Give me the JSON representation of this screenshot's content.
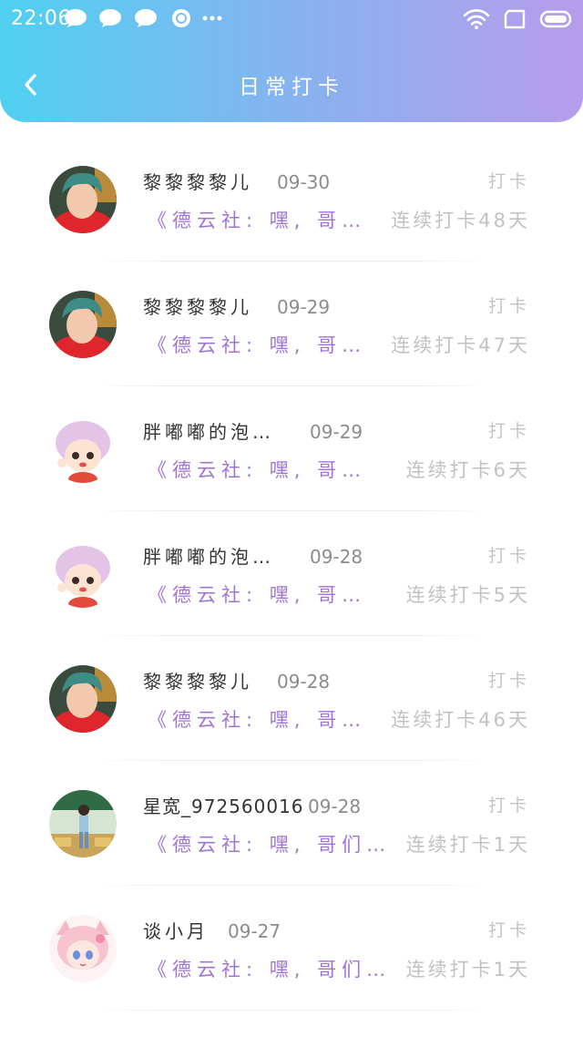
{
  "status_bar": {
    "time": "22:06"
  },
  "nav": {
    "title": "日常打卡"
  },
  "items": [
    {
      "name": "黎黎黎黎儿",
      "date": "09-30",
      "action": "打卡",
      "excerpt": "《德云社: 嘿, 哥…",
      "streak": "连续打卡48天",
      "avatar": "avatar-boy-green-hair"
    },
    {
      "name": "黎黎黎黎儿",
      "date": "09-29",
      "action": "打卡",
      "excerpt": "《德云社: 嘿, 哥…",
      "streak": "连续打卡47天",
      "avatar": "avatar-boy-green-hair"
    },
    {
      "name": "胖嘟嘟的泡…",
      "date": "09-29",
      "action": "打卡",
      "excerpt": "《德云社: 嘿, 哥…",
      "streak": "连续打卡6天",
      "avatar": "avatar-cartoon-pink-hair"
    },
    {
      "name": "胖嘟嘟的泡…",
      "date": "09-28",
      "action": "打卡",
      "excerpt": "《德云社: 嘿, 哥…",
      "streak": "连续打卡5天",
      "avatar": "avatar-cartoon-pink-hair"
    },
    {
      "name": "黎黎黎黎儿",
      "date": "09-28",
      "action": "打卡",
      "excerpt": "《德云社: 嘿, 哥…",
      "streak": "连续打卡46天",
      "avatar": "avatar-boy-green-hair"
    },
    {
      "name": "星宽_972560016",
      "date": "09-28",
      "action": "打卡",
      "excerpt": "《德云社: 嘿, 哥们…",
      "streak": "连续打卡1天",
      "avatar": "avatar-person-classroom"
    },
    {
      "name": "谈小月",
      "date": "09-27",
      "action": "打卡",
      "excerpt": "《德云社: 嘿, 哥们…",
      "streak": "连续打卡1天",
      "avatar": "avatar-anime-pink-girl"
    }
  ]
}
